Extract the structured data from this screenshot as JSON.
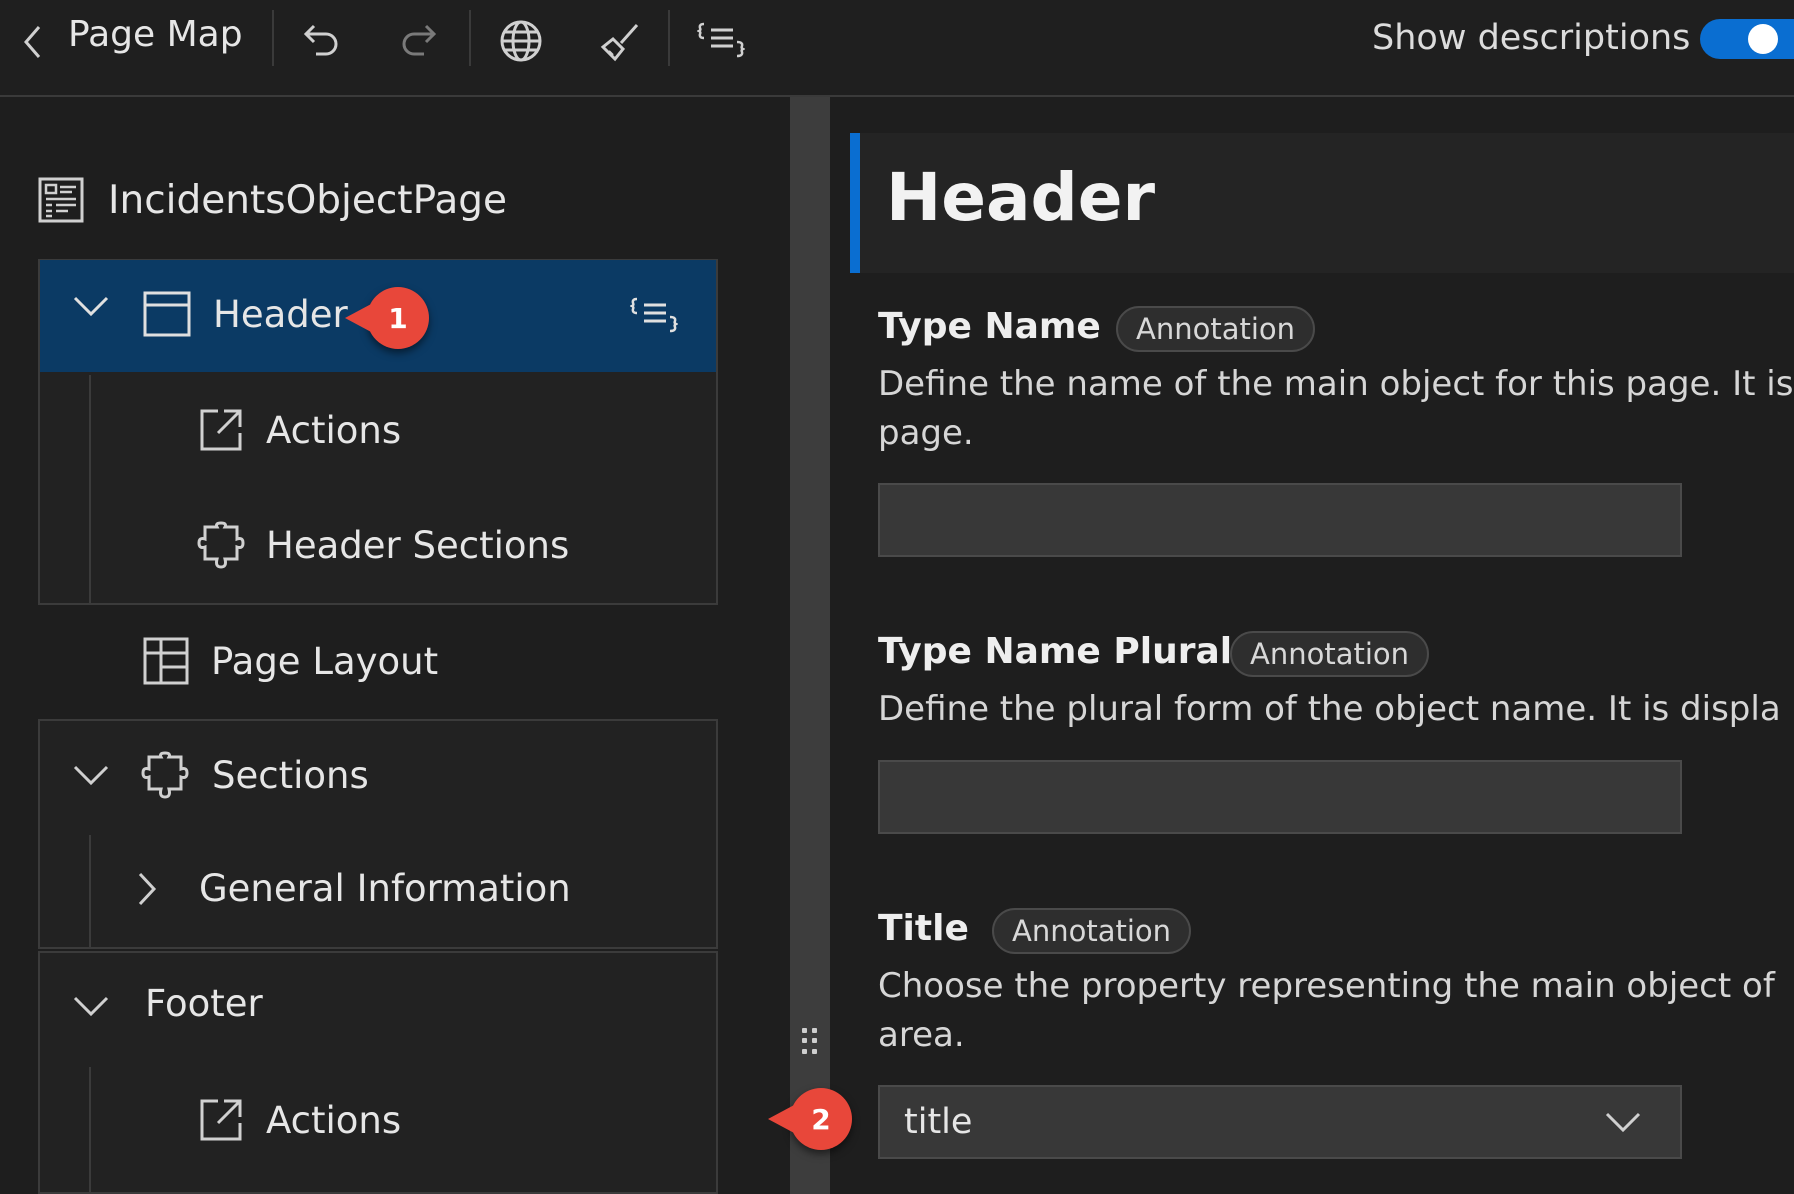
{
  "toolbar": {
    "title": "Page Map",
    "show_descriptions_label": "Show descriptions",
    "show_descriptions_on": true,
    "icons": [
      "back-icon",
      "undo-icon",
      "redo-icon",
      "globe-icon",
      "brush-icon",
      "outline-icon"
    ]
  },
  "tree": {
    "root_label": "IncidentsObjectPage",
    "items": {
      "header": "Header",
      "header_actions": "Actions",
      "header_sections": "Header Sections",
      "page_layout": "Page Layout",
      "sections": "Sections",
      "general_information": "General Information",
      "footer": "Footer",
      "footer_actions": "Actions"
    }
  },
  "callouts": {
    "first": "1",
    "second": "2"
  },
  "properties": {
    "heading": "Header",
    "type_name": {
      "label": "Type Name",
      "badge": "Annotation",
      "desc_line1": "Define the name of the main object for this page. It is",
      "desc_line2": "page.",
      "value": ""
    },
    "type_name_plural": {
      "label": "Type Name Plural",
      "badge": "Annotation",
      "desc_line1": "Define the plural form of the object name. It is displa",
      "value": ""
    },
    "title": {
      "label": "Title",
      "badge": "Annotation",
      "desc_line1": "Choose the property representing the main object of",
      "desc_line2": "area.",
      "value": "title"
    }
  },
  "colors": {
    "accent": "#0a6ed1",
    "selected_row": "#0b3a64",
    "callout": "#e8473a"
  }
}
